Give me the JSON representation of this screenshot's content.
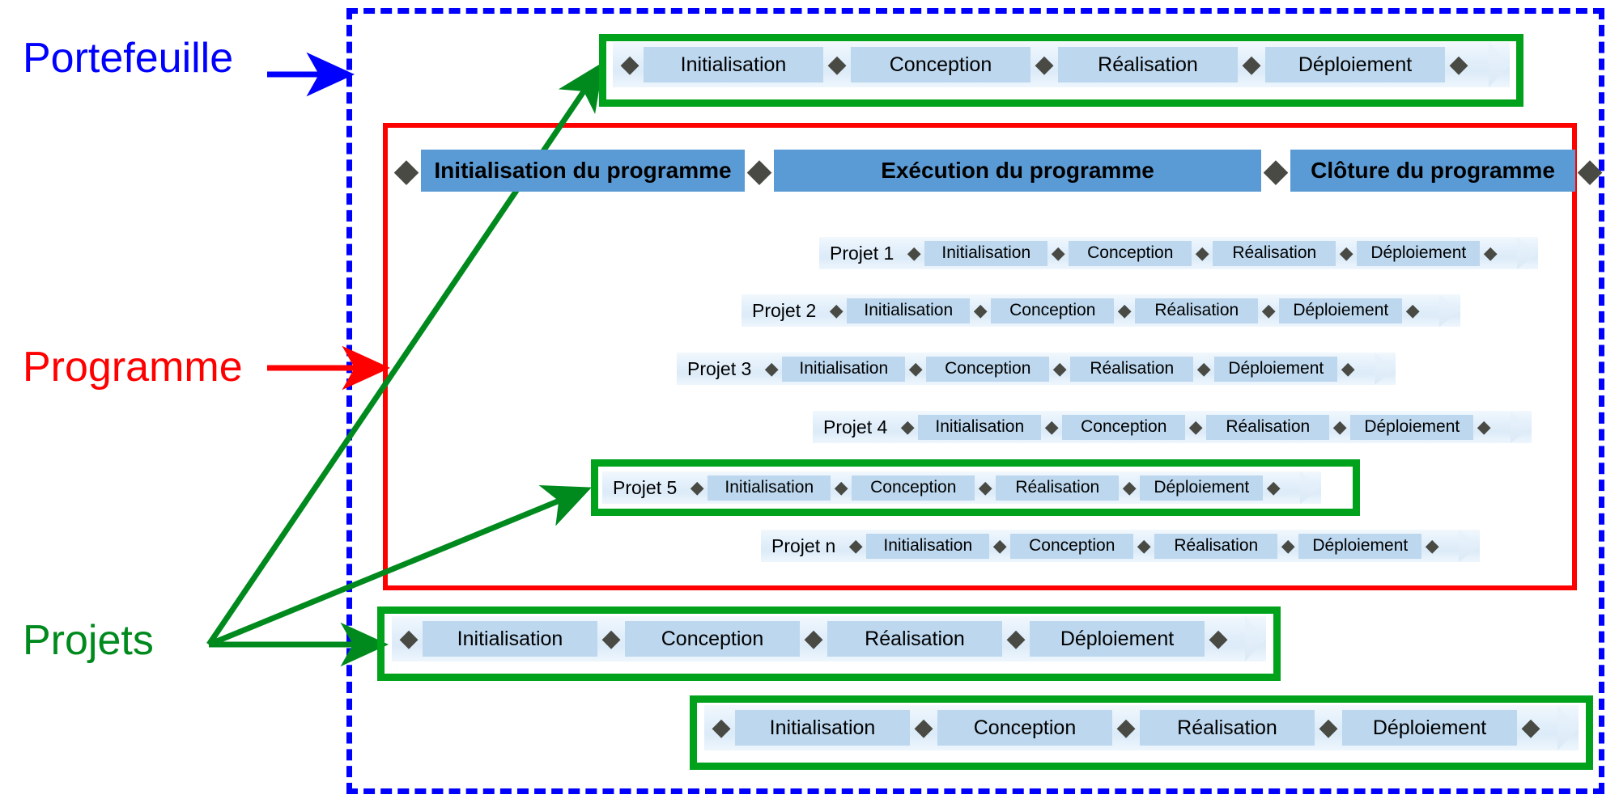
{
  "title": "Portefeuille / Programme / Projets",
  "labels": {
    "portfolio": "Portefeuille",
    "programme": "Programme",
    "projects": "Projets"
  },
  "colors": {
    "portfolio_border": "#0000ff",
    "programme_border": "#ff0000",
    "project_highlight": "#00a21c",
    "phase_fill": "#bcd7ee",
    "programme_phase_fill": "#5b9bd5",
    "diamond": "#4a4a45"
  },
  "phases": [
    "Initialisation",
    "Conception",
    "Réalisation",
    "Déploiement"
  ],
  "diamond_glyph": "◆",
  "programme_phases": [
    "Initialisation du programme",
    "Exécution du programme",
    "Clôture du programme"
  ],
  "portfolio_timeline": {
    "name": "portfolio-top-timeline",
    "highlighted": true,
    "phases": [
      "Initialisation",
      "Conception",
      "Réalisation",
      "Déploiement"
    ]
  },
  "projects": [
    {
      "label": "Projet 1",
      "highlighted": false,
      "phases": [
        "Initialisation",
        "Conception",
        "Réalisation",
        "Déploiement"
      ]
    },
    {
      "label": "Projet 2",
      "highlighted": false,
      "phases": [
        "Initialisation",
        "Conception",
        "Réalisation",
        "Déploiement"
      ]
    },
    {
      "label": "Projet 3",
      "highlighted": false,
      "phases": [
        "Initialisation",
        "Conception",
        "Réalisation",
        "Déploiement"
      ]
    },
    {
      "label": "Projet 4",
      "highlighted": false,
      "phases": [
        "Initialisation",
        "Conception",
        "Réalisation",
        "Déploiement"
      ]
    },
    {
      "label": "Projet 5",
      "highlighted": true,
      "phases": [
        "Initialisation",
        "Conception",
        "Réalisation",
        "Déploiement"
      ]
    },
    {
      "label": "Projet n",
      "highlighted": false,
      "phases": [
        "Initialisation",
        "Conception",
        "Réalisation",
        "Déploiement"
      ]
    }
  ],
  "standalone_timelines": [
    {
      "name": "standalone-project-timeline-1",
      "highlighted": true,
      "phases": [
        "Initialisation",
        "Conception",
        "Réalisation",
        "Déploiement"
      ]
    },
    {
      "name": "standalone-project-timeline-2",
      "highlighted": true,
      "phases": [
        "Initialisation",
        "Conception",
        "Réalisation",
        "Déploiement"
      ]
    }
  ],
  "arrows": {
    "portfolio_arrow": "→",
    "programme_arrow": "→",
    "projects_arrow": "→"
  }
}
